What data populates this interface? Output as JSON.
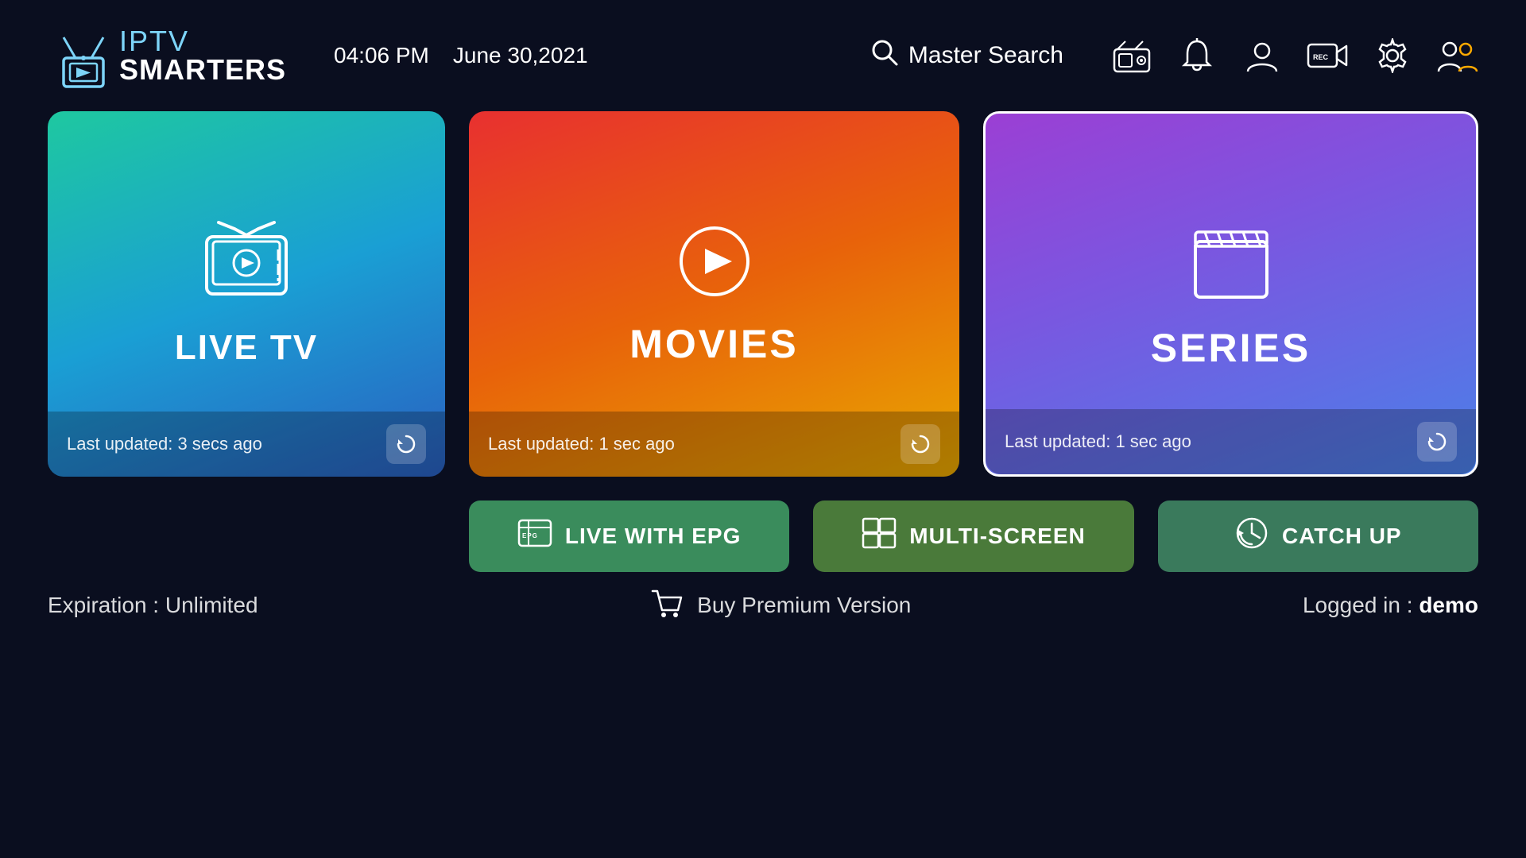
{
  "header": {
    "logo_iptv": "IPTV",
    "logo_smarters": "SMARTERS",
    "time": "04:06 PM",
    "date": "June 30,2021",
    "search_label": "Master Search"
  },
  "cards": {
    "live_tv": {
      "title": "LIVE TV",
      "last_updated": "Last updated: 3 secs ago"
    },
    "movies": {
      "title": "MOVIES",
      "last_updated": "Last updated: 1 sec ago"
    },
    "series": {
      "title": "SERIES",
      "last_updated": "Last updated: 1 sec ago"
    }
  },
  "buttons": {
    "live_epg": "LIVE WITH EPG",
    "multiscreen": "MULTI-SCREEN",
    "catchup": "CATCH UP"
  },
  "footer": {
    "expiry": "Expiration : Unlimited",
    "premium": "Buy Premium Version",
    "logged_in_label": "Logged in : ",
    "logged_in_user": "demo"
  }
}
